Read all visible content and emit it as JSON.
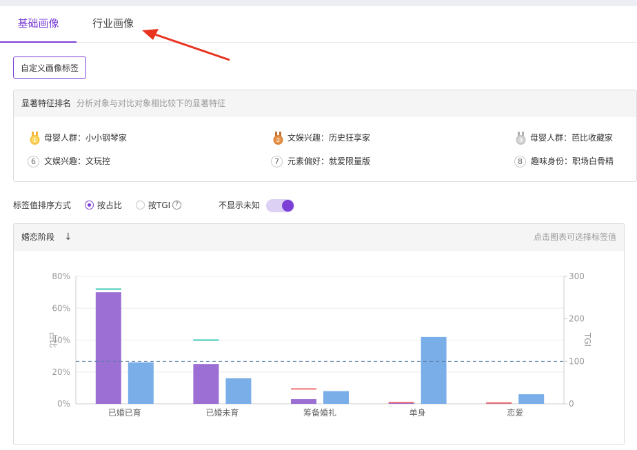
{
  "tabs": [
    {
      "label": "基础画像",
      "active": true
    },
    {
      "label": "行业画像",
      "active": false
    }
  ],
  "custom_button": "自定义画像标签",
  "features": {
    "title": "显著特征排名",
    "subtitle": "分析对象与对比对象相比较下的显著特征",
    "items": [
      {
        "rank": "1",
        "text": "母婴人群：小小钢琴家",
        "medal": "gold"
      },
      {
        "rank": "2",
        "text": "文娱兴趣：历史狂享家",
        "medal": "bronze"
      },
      {
        "rank": "3",
        "text": "母婴人群：芭比收藏家",
        "medal": "silver"
      },
      {
        "rank": "6",
        "text": "文娱兴趣：文玩控",
        "medal": "none"
      },
      {
        "rank": "7",
        "text": "元素偏好：就爱限量版",
        "medal": "none"
      },
      {
        "rank": "8",
        "text": "趣味身份：职场白骨精",
        "medal": "none"
      }
    ]
  },
  "sort": {
    "label": "标签值排序方式",
    "options": [
      {
        "label": "按占比",
        "selected": true
      },
      {
        "label": "按TGI",
        "selected": false
      }
    ],
    "help_icon": "question-circle-icon",
    "toggle_label": "不显示未知",
    "toggle_on": true
  },
  "chart_card": {
    "title": "婚恋阶段",
    "sort_icon": "arrow-down-icon",
    "hint": "点击图表可选择标签值"
  },
  "colors": {
    "accent": "#7b3fd6",
    "bar_purple": "#9b6fd3",
    "bar_blue": "#7aaee8",
    "tgi_green": "#37c7b0",
    "tgi_red": "#f07070",
    "baseline": "#5b7fa8"
  },
  "chart_data": {
    "type": "bar",
    "categories": [
      "已婚已育",
      "已婚未育",
      "筹备婚礼",
      "单身",
      "恋爱"
    ],
    "series": [
      {
        "values": [
          70,
          25,
          3,
          0.8,
          0.5
        ],
        "axis": "left",
        "color": "#9b6fd3"
      },
      {
        "values": [
          26,
          16,
          8,
          42,
          6
        ],
        "axis": "left",
        "color": "#7aaee8"
      }
    ],
    "tgi": {
      "values": [
        270,
        150,
        35,
        3,
        2
      ],
      "colors": [
        "#37c7b0",
        "#37c7b0",
        "#f07070",
        "#f07070",
        "#f07070"
      ]
    },
    "tgi_baseline": 100,
    "ylabel": "占比",
    "y2label": "TGI",
    "yticks": [
      "0%",
      "20%",
      "40%",
      "60%",
      "80%"
    ],
    "y2ticks": [
      "0",
      "100",
      "200",
      "300"
    ],
    "ylim": [
      0,
      80
    ],
    "y2lim": [
      0,
      300
    ],
    "grid": true
  }
}
